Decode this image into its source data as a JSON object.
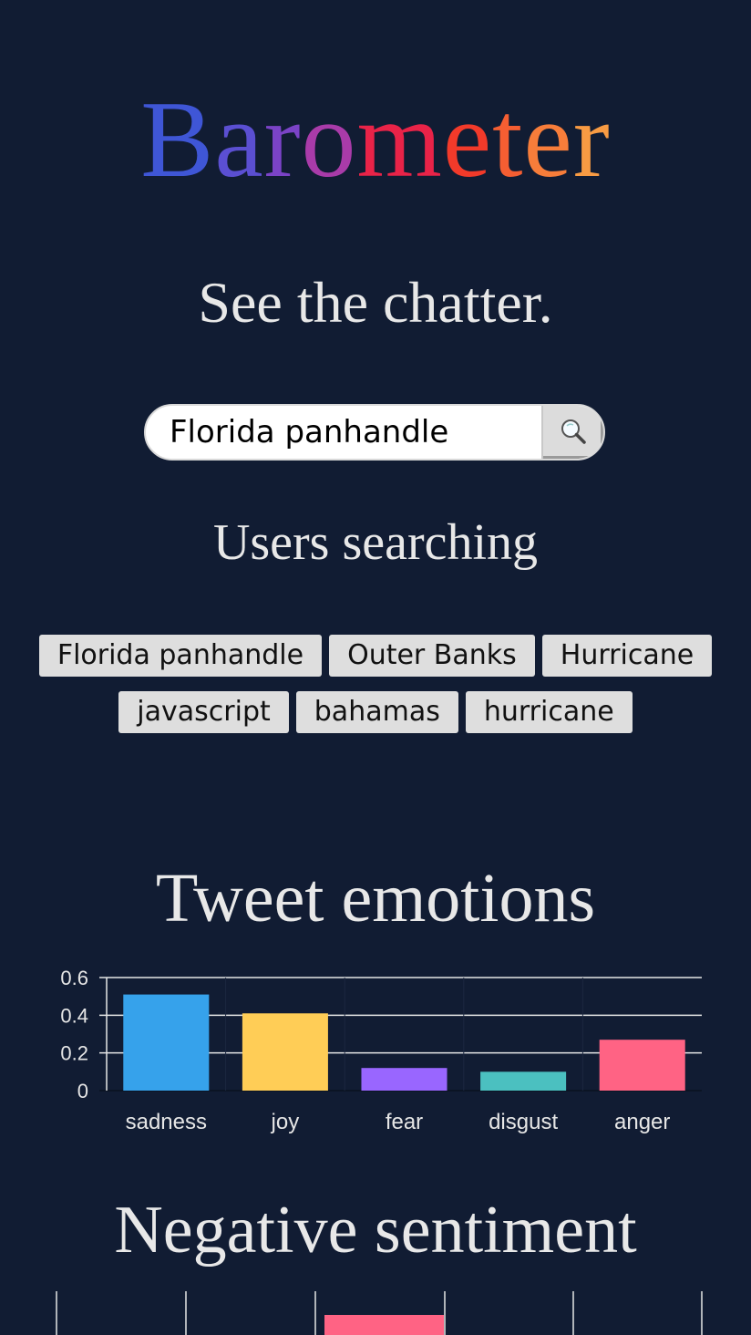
{
  "brand": {
    "title": "Barometer",
    "gradient": [
      "#3f56d6",
      "#5b4fd2",
      "#7b43c7",
      "#a93ba9",
      "#cf2f7d",
      "#e92348",
      "#f23a2a",
      "#f55e32",
      "#f77d3a",
      "#f89b43"
    ]
  },
  "tagline": "See the chatter.",
  "search": {
    "value": "Florida panhandle",
    "icon": "magnifier-icon"
  },
  "users_searching": {
    "heading": "Users searching",
    "chips": [
      "Florida panhandle",
      "Outer Banks",
      "Hurricane",
      "javascript",
      "bahamas",
      "hurricane"
    ]
  },
  "emotions": {
    "heading": "Tweet emotions"
  },
  "negative": {
    "heading": "Negative sentiment"
  },
  "colors": {
    "background": "#111c33",
    "chip_bg": "#dedede"
  },
  "chart_data": [
    {
      "type": "bar",
      "title": "Tweet emotions",
      "categories": [
        "sadness",
        "joy",
        "fear",
        "disgust",
        "anger"
      ],
      "values": [
        0.51,
        0.41,
        0.12,
        0.1,
        0.27
      ],
      "colors": [
        "#36a2eb",
        "#ffcd56",
        "#9966ff",
        "#4bc0c0",
        "#ff6384"
      ],
      "ylim": [
        0,
        0.6
      ],
      "yticks": [
        "0",
        "0.2",
        "0.4",
        "0.6"
      ],
      "grid": true,
      "xlabel": "",
      "ylabel": ""
    },
    {
      "type": "bar",
      "title": "Negative sentiment",
      "note": "partially visible (cropped at bottom)",
      "bar_color": "#ff6384",
      "grid": true
    }
  ]
}
